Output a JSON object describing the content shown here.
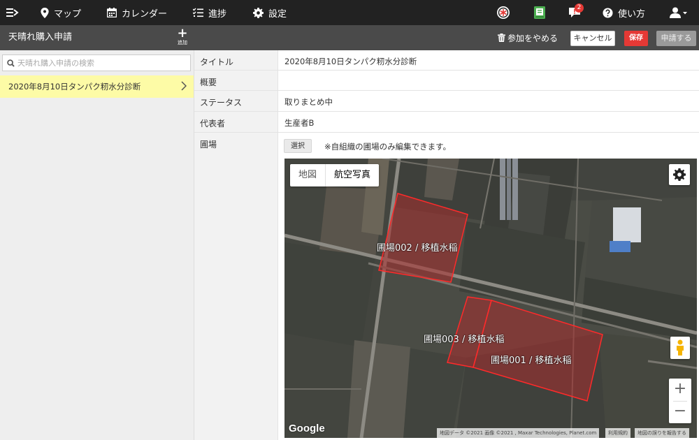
{
  "nav": {
    "map": "マップ",
    "calendar": "カレンダー",
    "progress": "進捗",
    "settings": "設定",
    "notifications_count": "2",
    "help": "使い方"
  },
  "subheader": {
    "title": "天晴れ購入申請",
    "add_label": "追加",
    "leave_label": "参加をやめる",
    "cancel_label": "キャンセル",
    "save_label": "保存",
    "apply_label": "申請する"
  },
  "sidebar": {
    "search_placeholder": "天晴れ購入申請の検索",
    "items": [
      {
        "label": "2020年8月10日タンパク籾水分診断"
      }
    ]
  },
  "form": {
    "title_label": "タイトル",
    "title_value": "2020年8月10日タンパク籾水分診断",
    "summary_label": "概要",
    "summary_value": "",
    "status_label": "ステータス",
    "status_value": "取りまとめ中",
    "representative_label": "代表者",
    "representative_value": "生産者B",
    "field_label": "圃場",
    "select_label": "選択",
    "note": "※自組織の圃場のみ編集できます。"
  },
  "map": {
    "type_map": "地図",
    "type_satellite": "航空写真",
    "active_type": "航空写真",
    "zoom_in": "+",
    "zoom_out": "−",
    "logo": "Google",
    "attribution": "地図データ ©2021 画像 ©2021 , Maxar Technologies, Planet.com",
    "terms": "利用規約",
    "report": "地図の誤りを報告する",
    "fields": [
      {
        "label": "圃場002 / 移植水稲"
      },
      {
        "label": "圃場003 / 移植水稲"
      },
      {
        "label": "圃場001 / 移植水稲"
      }
    ]
  },
  "colors": {
    "topnav_bg": "#222222",
    "subheader_bg": "#4a4a4a",
    "selected_item_bg": "#fdfba6",
    "save_button": "#e53935",
    "field_outline": "#ff2a2a"
  }
}
